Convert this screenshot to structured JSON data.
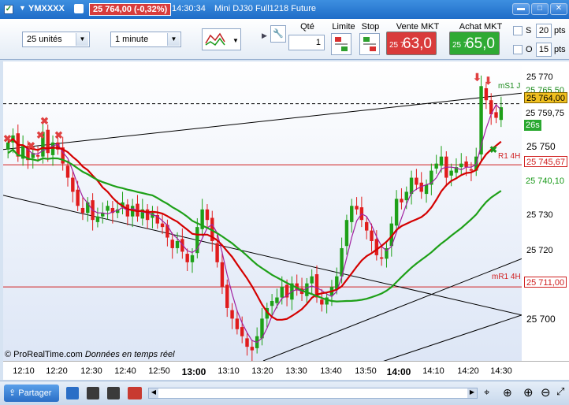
{
  "title": {
    "symbol": "YMXXXX",
    "price_badge": "25 764,00 (-0,32%)",
    "time": "14:30:34",
    "instrument": "Mini DJ30 Full1218 Future"
  },
  "toolbar": {
    "quantity_select": "25 unités",
    "interval_select": "1 minute",
    "qty_label": "Qté",
    "qty_value": "1",
    "limit_label": "Limite",
    "stop_label": "Stop",
    "sell_label": "Vente MKT",
    "buy_label": "Achat MKT",
    "sell_small": "25 7",
    "sell_big": "63,0",
    "buy_small": "25 7",
    "buy_big": "65,0",
    "s_label": "S",
    "s_value": "20",
    "o_label": "O",
    "o_value": "15",
    "pts": "pts",
    "sell_color": "#d93b3b",
    "buy_color": "#2faa34"
  },
  "price_axis": {
    "ticks": [
      "25 770",
      "25 760",
      "25 750",
      "25 730",
      "25 720",
      "25 700"
    ],
    "tags": {
      "ms1": "25 765,50",
      "last": "25 764,00",
      "ma": "25 759,75",
      "timer": "26s",
      "r1": "25 745,67",
      "green_ma": "25 740,10",
      "mr1": "25 711,00"
    },
    "labels": {
      "ms1": "mS1 J",
      "r1": "R1 4H",
      "mr1": "mR1 4H"
    }
  },
  "time_axis": [
    "12:10",
    "12:20",
    "12:30",
    "12:40",
    "12:50",
    "13:00",
    "13:10",
    "13:20",
    "13:30",
    "13:40",
    "13:50",
    "14:00",
    "14:10",
    "14:20",
    "14:30"
  ],
  "watermark": {
    "brand": "© ProRealTime.com",
    "note": "Données en temps réel"
  },
  "status": {
    "share": "Partager"
  },
  "chart_data": {
    "type": "candlestick",
    "ylim": [
      25690,
      25775
    ],
    "close_series": [
      25752,
      25754,
      25748,
      25751,
      25747,
      25749,
      25748,
      25755,
      25749,
      25752,
      25750,
      25746,
      25742,
      25738,
      25734,
      25732,
      25735,
      25730,
      25731,
      25732,
      25734,
      25732,
      25733,
      25735,
      25731,
      25734,
      25731,
      25733,
      25730,
      25732,
      25729,
      25728,
      25725,
      25722,
      25724,
      25721,
      25718,
      25720,
      25728,
      25733,
      25730,
      25724,
      25718,
      25711,
      25705,
      25702,
      25699,
      25697,
      25694,
      25693,
      25697,
      25702,
      25705,
      25707,
      25708,
      25711,
      25708,
      25712,
      25710,
      25709,
      25712,
      25714,
      25708,
      25706,
      25708,
      25711,
      25714,
      25722,
      25730,
      25734,
      25733,
      25730,
      25727,
      25724,
      25720,
      25719,
      25722,
      25729,
      25736,
      25735,
      25738,
      25742,
      25740,
      25738,
      25740,
      25744,
      25746,
      25748,
      25742,
      25744,
      25745,
      25746,
      25745,
      25744,
      25748,
      25768,
      25764,
      25760,
      25759,
      25762
    ],
    "series": [
      {
        "name": "",
        "color": "#d40000"
      },
      {
        "name": "",
        "color": "#1ea018"
      },
      {
        "name": "",
        "color": "#a020a0"
      }
    ]
  }
}
